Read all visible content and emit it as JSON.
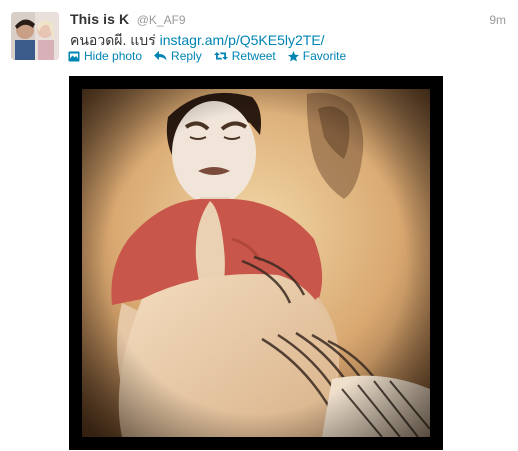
{
  "tweet": {
    "author": {
      "fullname": "This is K",
      "username": "@K_AF9"
    },
    "timestamp": "9m",
    "text": "คนอวดผี. แบร่",
    "link": "instagr.am/p/Q5KE5ly2TE/",
    "actions": {
      "hide_photo": "Hide photo",
      "reply": "Reply",
      "retweet": "Retweet",
      "favorite": "Favorite"
    }
  },
  "colors": {
    "link": "#0084b4",
    "name": "#333333",
    "meta": "#999999",
    "media_frame": "#000000"
  },
  "icons": {
    "hide_photo": "photo-icon",
    "reply": "reply-arrow-icon",
    "retweet": "retweet-icon",
    "favorite": "star-icon"
  }
}
